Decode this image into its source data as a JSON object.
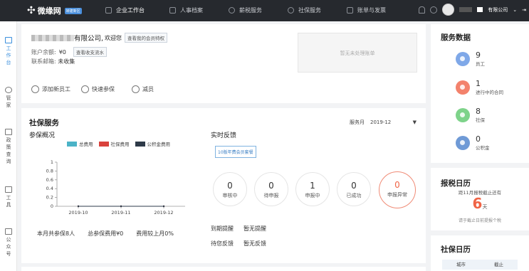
{
  "header": {
    "logo_text": "微缘网",
    "logo_badge": "转建新区",
    "nav": [
      {
        "label": "企业工作台",
        "icon": "desktop-icon",
        "active": true
      },
      {
        "label": "人事档案",
        "icon": "folder-icon",
        "active": false
      },
      {
        "label": "薪税服务",
        "icon": "coin-icon",
        "active": false
      },
      {
        "label": "社保服务",
        "icon": "shield-icon",
        "active": false
      },
      {
        "label": "账单与发票",
        "icon": "invoice-icon",
        "active": false
      }
    ],
    "company_suffix": "有限公司",
    "dropdown_icon": "chevron-down-icon",
    "exit_icon": "exit-icon"
  },
  "sidebar": {
    "items": [
      {
        "label": "工作台",
        "icon": "dashboard-icon",
        "active": true
      },
      {
        "label": "管家",
        "icon": "user-icon",
        "active": false
      },
      {
        "label": "政策查询",
        "icon": "document-icon",
        "active": false
      },
      {
        "label": "工具",
        "icon": "toolbox-icon",
        "active": false
      },
      {
        "label": "公众号",
        "icon": "grid-icon",
        "active": false
      }
    ]
  },
  "company": {
    "name_suffix": "有限公司,",
    "welcome": "欢迎您",
    "vip_button": "查看我的会员特权",
    "balance_label": "账户余额:",
    "balance_value": "¥0",
    "flow_button": "查看收支流水",
    "email_label": "联系邮箱:",
    "email_value": "未收集",
    "pending_text": "暂无未处理账单"
  },
  "actions": {
    "add_employee": "添加新员工",
    "quick_enroll": "快速参保",
    "reduce": "减员"
  },
  "social": {
    "title": "社保服务",
    "overview_title": "参保概况",
    "month_label": "服务月",
    "month_value": "2019-12",
    "legend": [
      {
        "label": "总费用",
        "color": "#4bb3c7"
      },
      {
        "label": "社保费用",
        "color": "#d9423c"
      },
      {
        "label": "公积金费用",
        "color": "#2e3a48"
      }
    ],
    "summary": {
      "count": "本月共参保8人",
      "fee": "总参保费用¥0",
      "compare": "费用较上月0%"
    },
    "feedback_title": "实时反馈",
    "promo_tag": "10版年费会员套餐",
    "circles": [
      {
        "value": "0",
        "label": "审核中",
        "warn": false
      },
      {
        "value": "0",
        "label": "待申报",
        "warn": false
      },
      {
        "value": "1",
        "label": "申报中",
        "warn": false
      },
      {
        "value": "0",
        "label": "已成功",
        "warn": false
      },
      {
        "value": "0",
        "label": "申报异常",
        "warn": true
      }
    ],
    "reminders": [
      {
        "label": "到期提醒",
        "value": "暂无提醒"
      },
      {
        "label": "待您反馈",
        "value": "暂无反馈"
      }
    ]
  },
  "chart_data": {
    "type": "line",
    "categories": [
      "2019-10",
      "2019-11",
      "2019-12"
    ],
    "series": [
      {
        "name": "总费用",
        "values": [
          0,
          0,
          0
        ],
        "color": "#4bb3c7"
      },
      {
        "name": "社保费用",
        "values": [
          0,
          0,
          0
        ],
        "color": "#d9423c"
      },
      {
        "name": "公积金费用",
        "values": [
          0,
          0,
          0
        ],
        "color": "#2e3a48"
      }
    ],
    "yticks": [
      "0",
      "0.2",
      "0.4",
      "0.6",
      "0.8",
      "1"
    ],
    "ylim": [
      0,
      1
    ],
    "legend_position": "top"
  },
  "service_data": {
    "title": "服务数据",
    "items": [
      {
        "value": "9",
        "label": "员工",
        "color": "#7fa8e8"
      },
      {
        "value": "1",
        "label": "进行中的合同",
        "color": "#f3826c"
      },
      {
        "value": "8",
        "label": "社保",
        "color": "#7ed38a"
      },
      {
        "value": "0",
        "label": "公积金",
        "color": "#6f9ad6"
      }
    ]
  },
  "tax_calendar": {
    "title": "报税日历",
    "subtitle": "距11月报税截止还有",
    "days": "6",
    "days_unit": "天",
    "note": "请于截止日前提报个税"
  },
  "social_calendar": {
    "title": "社保日历",
    "columns": [
      "城市",
      "截止"
    ]
  }
}
